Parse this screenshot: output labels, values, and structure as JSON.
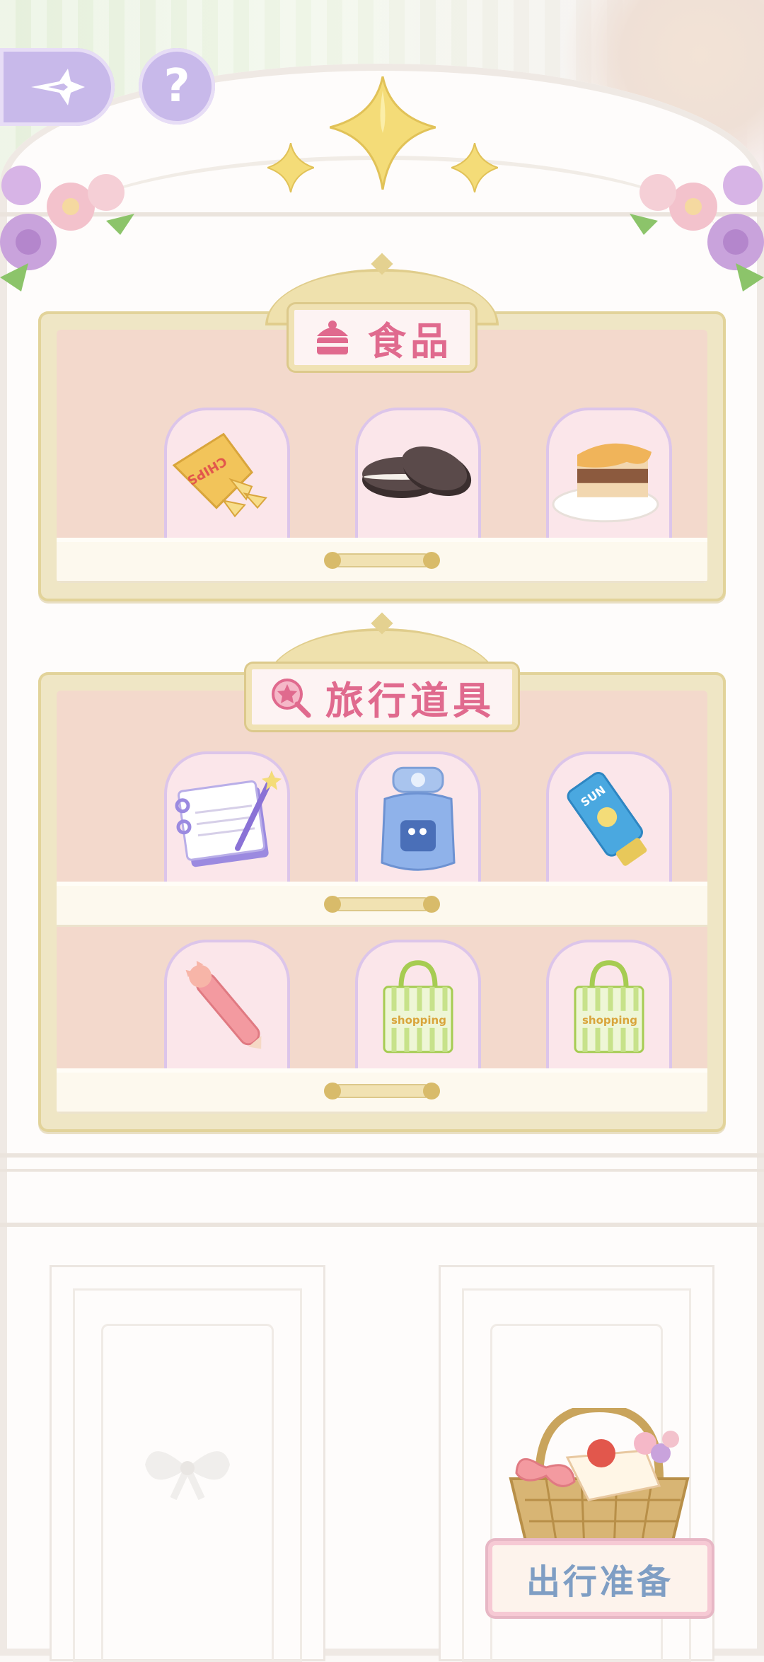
{
  "header": {
    "back_icon": "star-arrow-back-icon",
    "help_label": "?"
  },
  "sections": [
    {
      "title": "食品",
      "title_icon": "cake-icon",
      "rows": [
        [
          "chips-bag-icon",
          "sandwich-cookies-icon",
          "tiramisu-cake-icon"
        ]
      ]
    },
    {
      "title": "旅行道具",
      "title_icon": "magnifier-star-icon",
      "rows": [
        [
          "notebook-pen-icon",
          "water-bottle-icon",
          "sunscreen-tube-icon"
        ],
        [
          "cat-pen-icon",
          "shopping-bag-icon",
          "shopping-bag-icon"
        ]
      ]
    }
  ],
  "item_text": {
    "chips": "CHIPS",
    "sun": "SUN",
    "shopping": "shopping"
  },
  "footer": {
    "prepare_button": "出行准备"
  },
  "colors": {
    "accent_pink": "#e06a8e",
    "button_purple": "#c8b9ea",
    "shelf_gold": "#efe6c5",
    "shelf_back": "#f3d9cc",
    "prepare_text": "#7f9ec4"
  }
}
